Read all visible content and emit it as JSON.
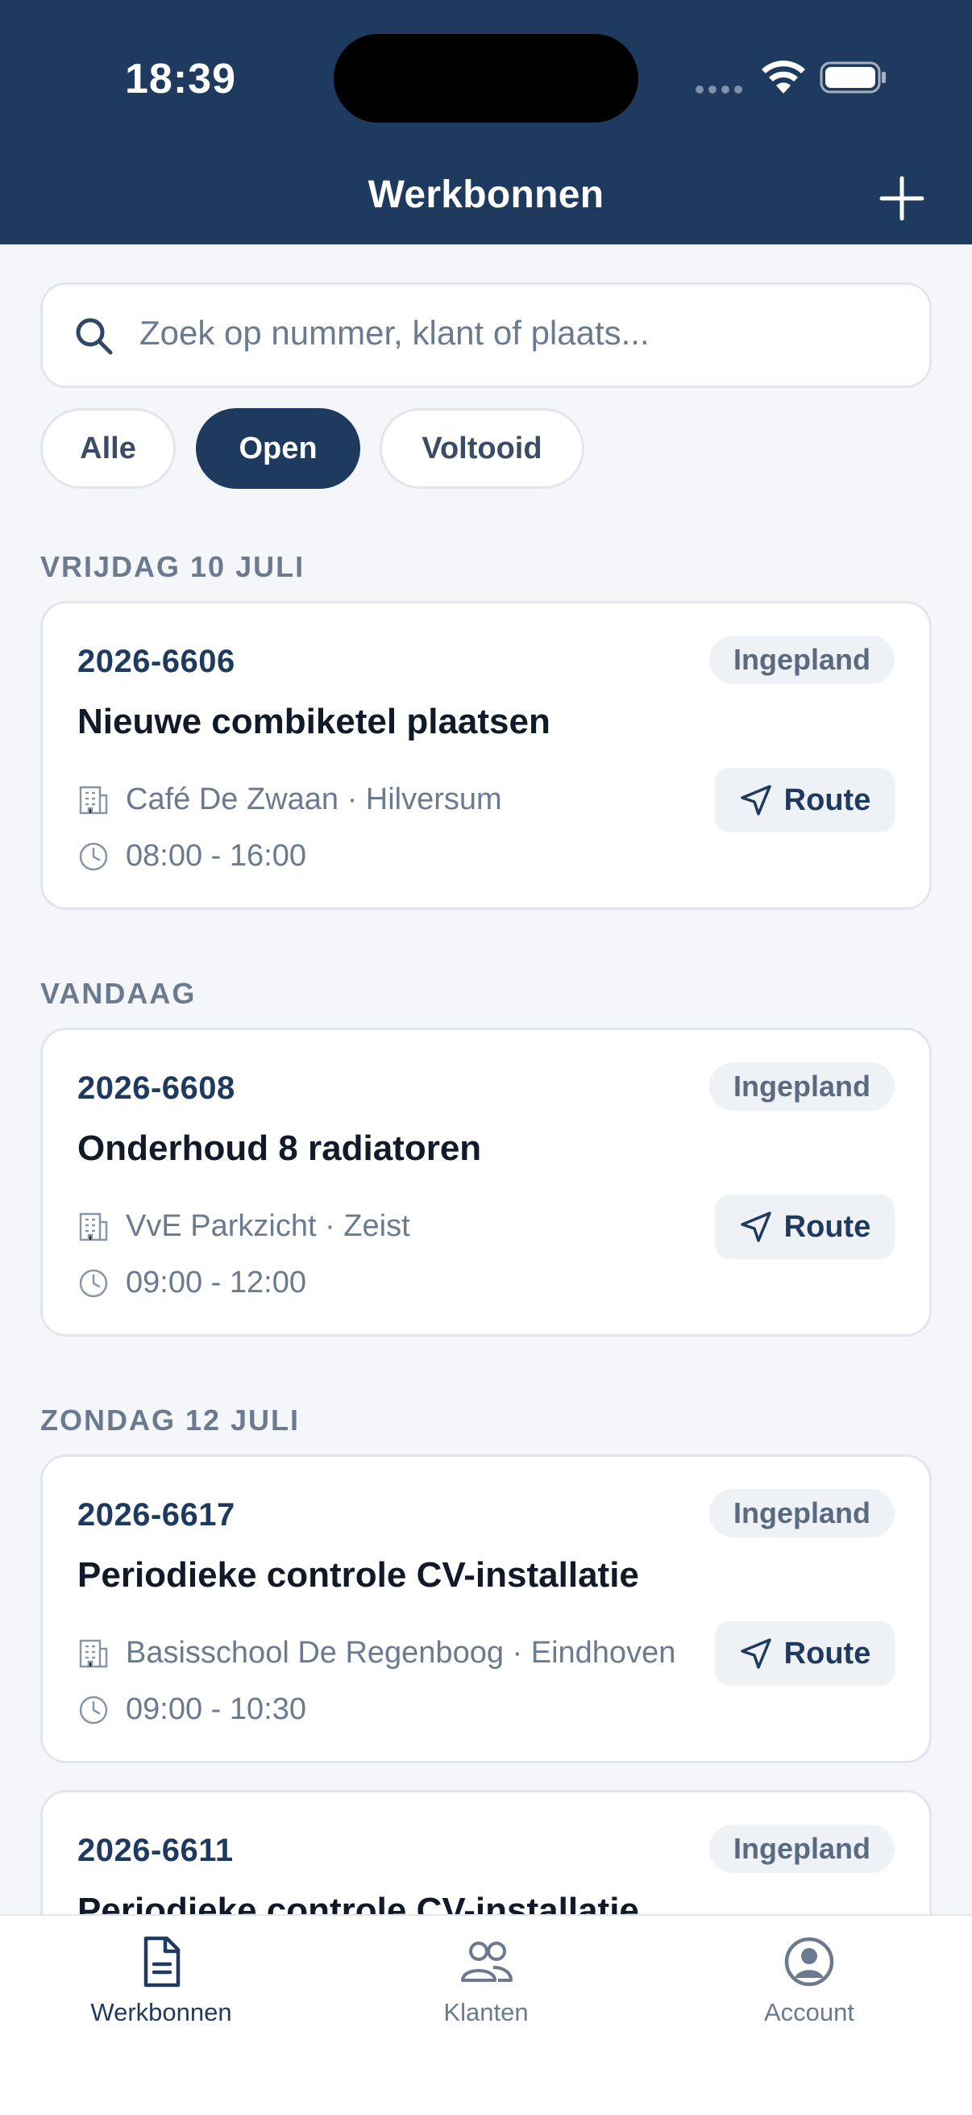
{
  "status_bar": {
    "time": "18:39"
  },
  "header": {
    "title": "Werkbonnen",
    "add_icon": "plus-icon"
  },
  "search": {
    "placeholder": "Zoek op nummer, klant of plaats..."
  },
  "filters": [
    {
      "label": "Alle",
      "active": false
    },
    {
      "label": "Open",
      "active": true
    },
    {
      "label": "Voltooid",
      "active": false
    }
  ],
  "sections": [
    {
      "label": "VRIJDAG 10 JULI",
      "cards": [
        {
          "number": "2026-6606",
          "status": "Ingepland",
          "title": "Nieuwe combiketel plaatsen",
          "client": "Café De Zwaan · Hilversum",
          "time": "08:00 - 16:00",
          "route_label": "Route"
        }
      ]
    },
    {
      "label": "VANDAAG",
      "cards": [
        {
          "number": "2026-6608",
          "status": "Ingepland",
          "title": "Onderhoud 8 radiatoren",
          "client": "VvE Parkzicht · Zeist",
          "time": "09:00 - 12:00",
          "route_label": "Route"
        }
      ]
    },
    {
      "label": "ZONDAG 12 JULI",
      "cards": [
        {
          "number": "2026-6617",
          "status": "Ingepland",
          "title": "Periodieke controle CV-installatie",
          "client": "Basisschool De Regenboog · Eindhoven",
          "time": "09:00 - 10:30",
          "route_label": "Route"
        },
        {
          "number": "2026-6611",
          "status": "Ingepland",
          "title": "Periodieke controle CV-installatie",
          "client": "",
          "time": "",
          "route_label": ""
        }
      ]
    }
  ],
  "tabbar": [
    {
      "label": "Werkbonnen",
      "icon": "document-icon",
      "active": true
    },
    {
      "label": "Klanten",
      "icon": "users-icon",
      "active": false
    },
    {
      "label": "Account",
      "icon": "account-icon",
      "active": false
    }
  ],
  "colors": {
    "primary": "#1f3a5f",
    "background": "#f4f6f9",
    "muted_text": "#6b7a8f",
    "badge_bg": "#eef1f5"
  }
}
